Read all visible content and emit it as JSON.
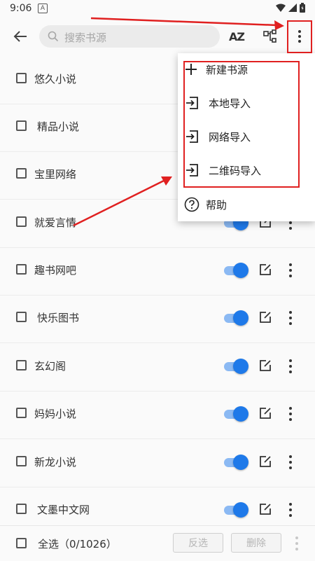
{
  "status": {
    "time": "9:06",
    "notification": "A"
  },
  "search": {
    "placeholder": "搜索书源"
  },
  "toolbar": {
    "sort_label": "AZ"
  },
  "sources": [
    {
      "name": "悠久小说",
      "enabled": null
    },
    {
      "name": "精品小说",
      "enabled": null
    },
    {
      "name": "宝里网络",
      "enabled": null
    },
    {
      "name": "就爱言情",
      "enabled": true
    },
    {
      "name": "趣书网吧",
      "enabled": true
    },
    {
      "name": "快乐图书",
      "enabled": true
    },
    {
      "name": "玄幻阁",
      "enabled": true
    },
    {
      "name": "妈妈小说",
      "enabled": true
    },
    {
      "name": "新龙小说",
      "enabled": true
    },
    {
      "name": "文墨中文网",
      "enabled": true
    }
  ],
  "bottom": {
    "select_all": "全选（0/1026）",
    "invert": "反选",
    "delete": "删除"
  },
  "menu": {
    "new_source": "新建书源",
    "local_import": "本地导入",
    "network_import": "网络导入",
    "qr_import": "二维码导入",
    "help": "帮助"
  },
  "colors": {
    "accent": "#1e79e9",
    "annotation": "#e02020"
  }
}
